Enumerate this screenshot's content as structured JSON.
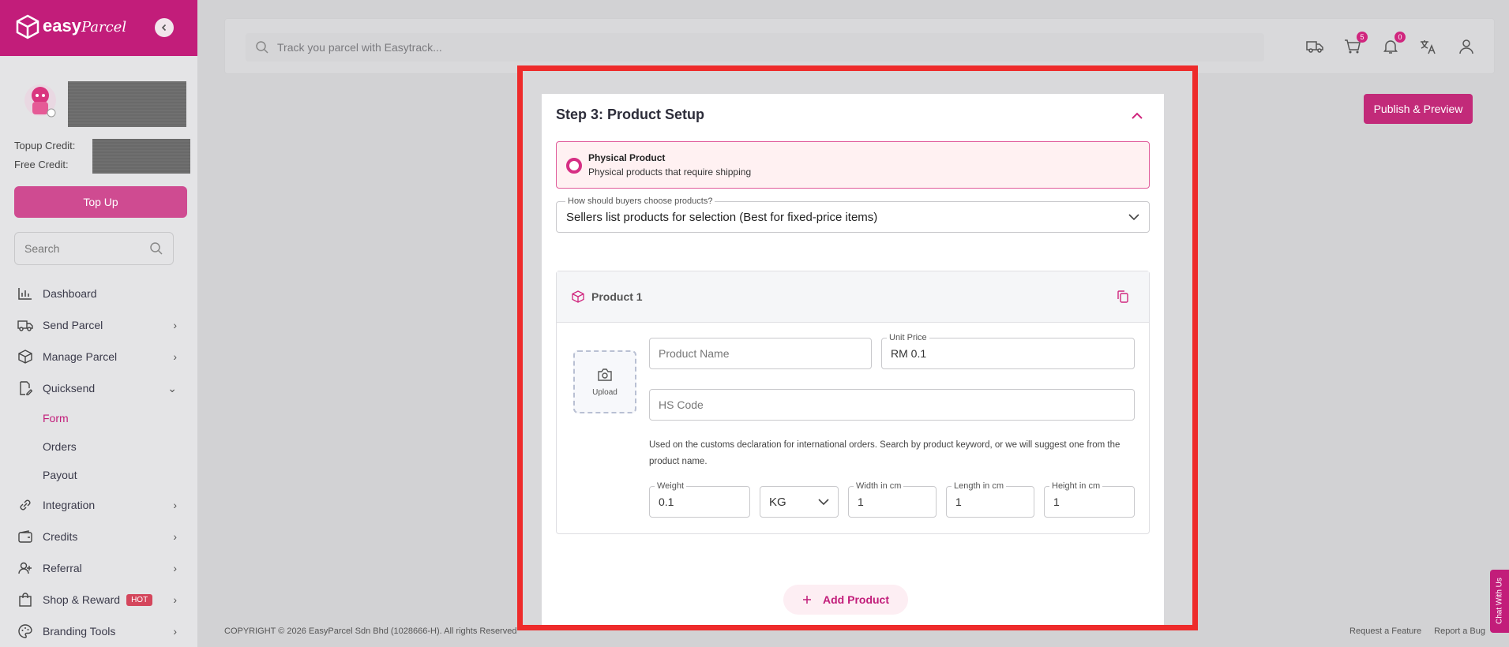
{
  "brand": {
    "name": "easy",
    "name_script": "Parcel"
  },
  "sidebar": {
    "topup_credit_label": "Topup Credit:",
    "free_credit_label": "Free Credit:",
    "topup_button": "Top Up",
    "search_placeholder": "Search",
    "items": [
      {
        "label": "Dashboard"
      },
      {
        "label": "Send Parcel"
      },
      {
        "label": "Manage Parcel"
      },
      {
        "label": "Quicksend"
      },
      {
        "label": "Form"
      },
      {
        "label": "Orders"
      },
      {
        "label": "Payout"
      },
      {
        "label": "Integration"
      },
      {
        "label": "Credits"
      },
      {
        "label": "Referral"
      },
      {
        "label": "Shop & Reward",
        "badge": "HOT"
      },
      {
        "label": "Branding Tools"
      }
    ]
  },
  "topbar": {
    "search_placeholder": "Track you parcel with Easytrack...",
    "cart_count": "5",
    "notification_count": "0"
  },
  "publish_button": "Publish & Preview",
  "step": {
    "title": "Step 3: Product Setup",
    "physical_title": "Physical Product",
    "physical_sub": "Physical products that require shipping",
    "choose_label": "How should buyers choose products?",
    "choose_value": "Sellers list products for selection (Best for fixed-price items)"
  },
  "product": {
    "title": "Product 1",
    "upload_label": "Upload",
    "name_placeholder": "Product Name",
    "price_label": "Unit Price",
    "price_value": "RM 0.1",
    "hs_placeholder": "HS Code",
    "helper_text": "Used on the customs declaration for international orders. Search by product keyword, or we will suggest one from the product name.",
    "weight_label": "Weight",
    "weight_value": "0.1",
    "unit_value": "KG",
    "width_label": "Width in cm",
    "width_value": "1",
    "length_label": "Length in cm",
    "length_value": "1",
    "height_label": "Height in cm",
    "height_value": "1"
  },
  "add_product": "Add Product",
  "footer": {
    "copyright": "COPYRIGHT © 2026 EasyParcel Sdn Bhd (1028666-H). All rights Reserved",
    "request_feature": "Request a Feature",
    "report_bug": "Report a Bug"
  },
  "chat": "Chat With Us",
  "colors": {
    "brand": "#c21d7a",
    "highlight": "#ee2b2b"
  }
}
